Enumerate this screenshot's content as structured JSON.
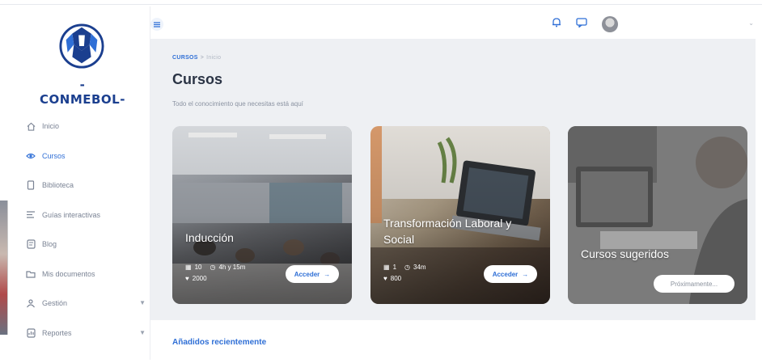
{
  "brand": {
    "name": "-CONMEBOL-",
    "color": "#1b3f8f"
  },
  "accent": "#2f6fd6",
  "sidebar": {
    "items": [
      {
        "label": "Inicio",
        "icon": "home-icon"
      },
      {
        "label": "Cursos",
        "icon": "eye-icon",
        "active": true
      },
      {
        "label": "Biblioteca",
        "icon": "book-icon"
      },
      {
        "label": "Guías interactivas",
        "icon": "list-icon"
      },
      {
        "label": "Blog",
        "icon": "blog-icon"
      },
      {
        "label": "Mis documentos",
        "icon": "folder-icon"
      },
      {
        "label": "Gestión",
        "icon": "people-icon",
        "expandable": true
      },
      {
        "label": "Reportes",
        "icon": "chart-icon",
        "expandable": true
      }
    ]
  },
  "header": {
    "menu_icon": "hamburger-icon",
    "icons": [
      "bell-icon",
      "chat-icon",
      "avatar"
    ]
  },
  "breadcrumb": {
    "section": "CURSOS",
    "separator": ">",
    "current": "Inicio"
  },
  "page": {
    "title": "Cursos",
    "subtitle": "Todo el conocimiento que necesitas está aquí"
  },
  "cards": [
    {
      "title": "Inducción",
      "modules": "10",
      "duration": "4h y 15m",
      "likes": "2000",
      "button": "Acceder"
    },
    {
      "title": "Transformación Laboral y Social",
      "modules": "1",
      "duration": "34m",
      "likes": "800",
      "button": "Acceder"
    },
    {
      "title": "Cursos sugeridos",
      "button": "Próximamente..."
    }
  ],
  "recent": {
    "title": "Añadidos recientemente"
  }
}
